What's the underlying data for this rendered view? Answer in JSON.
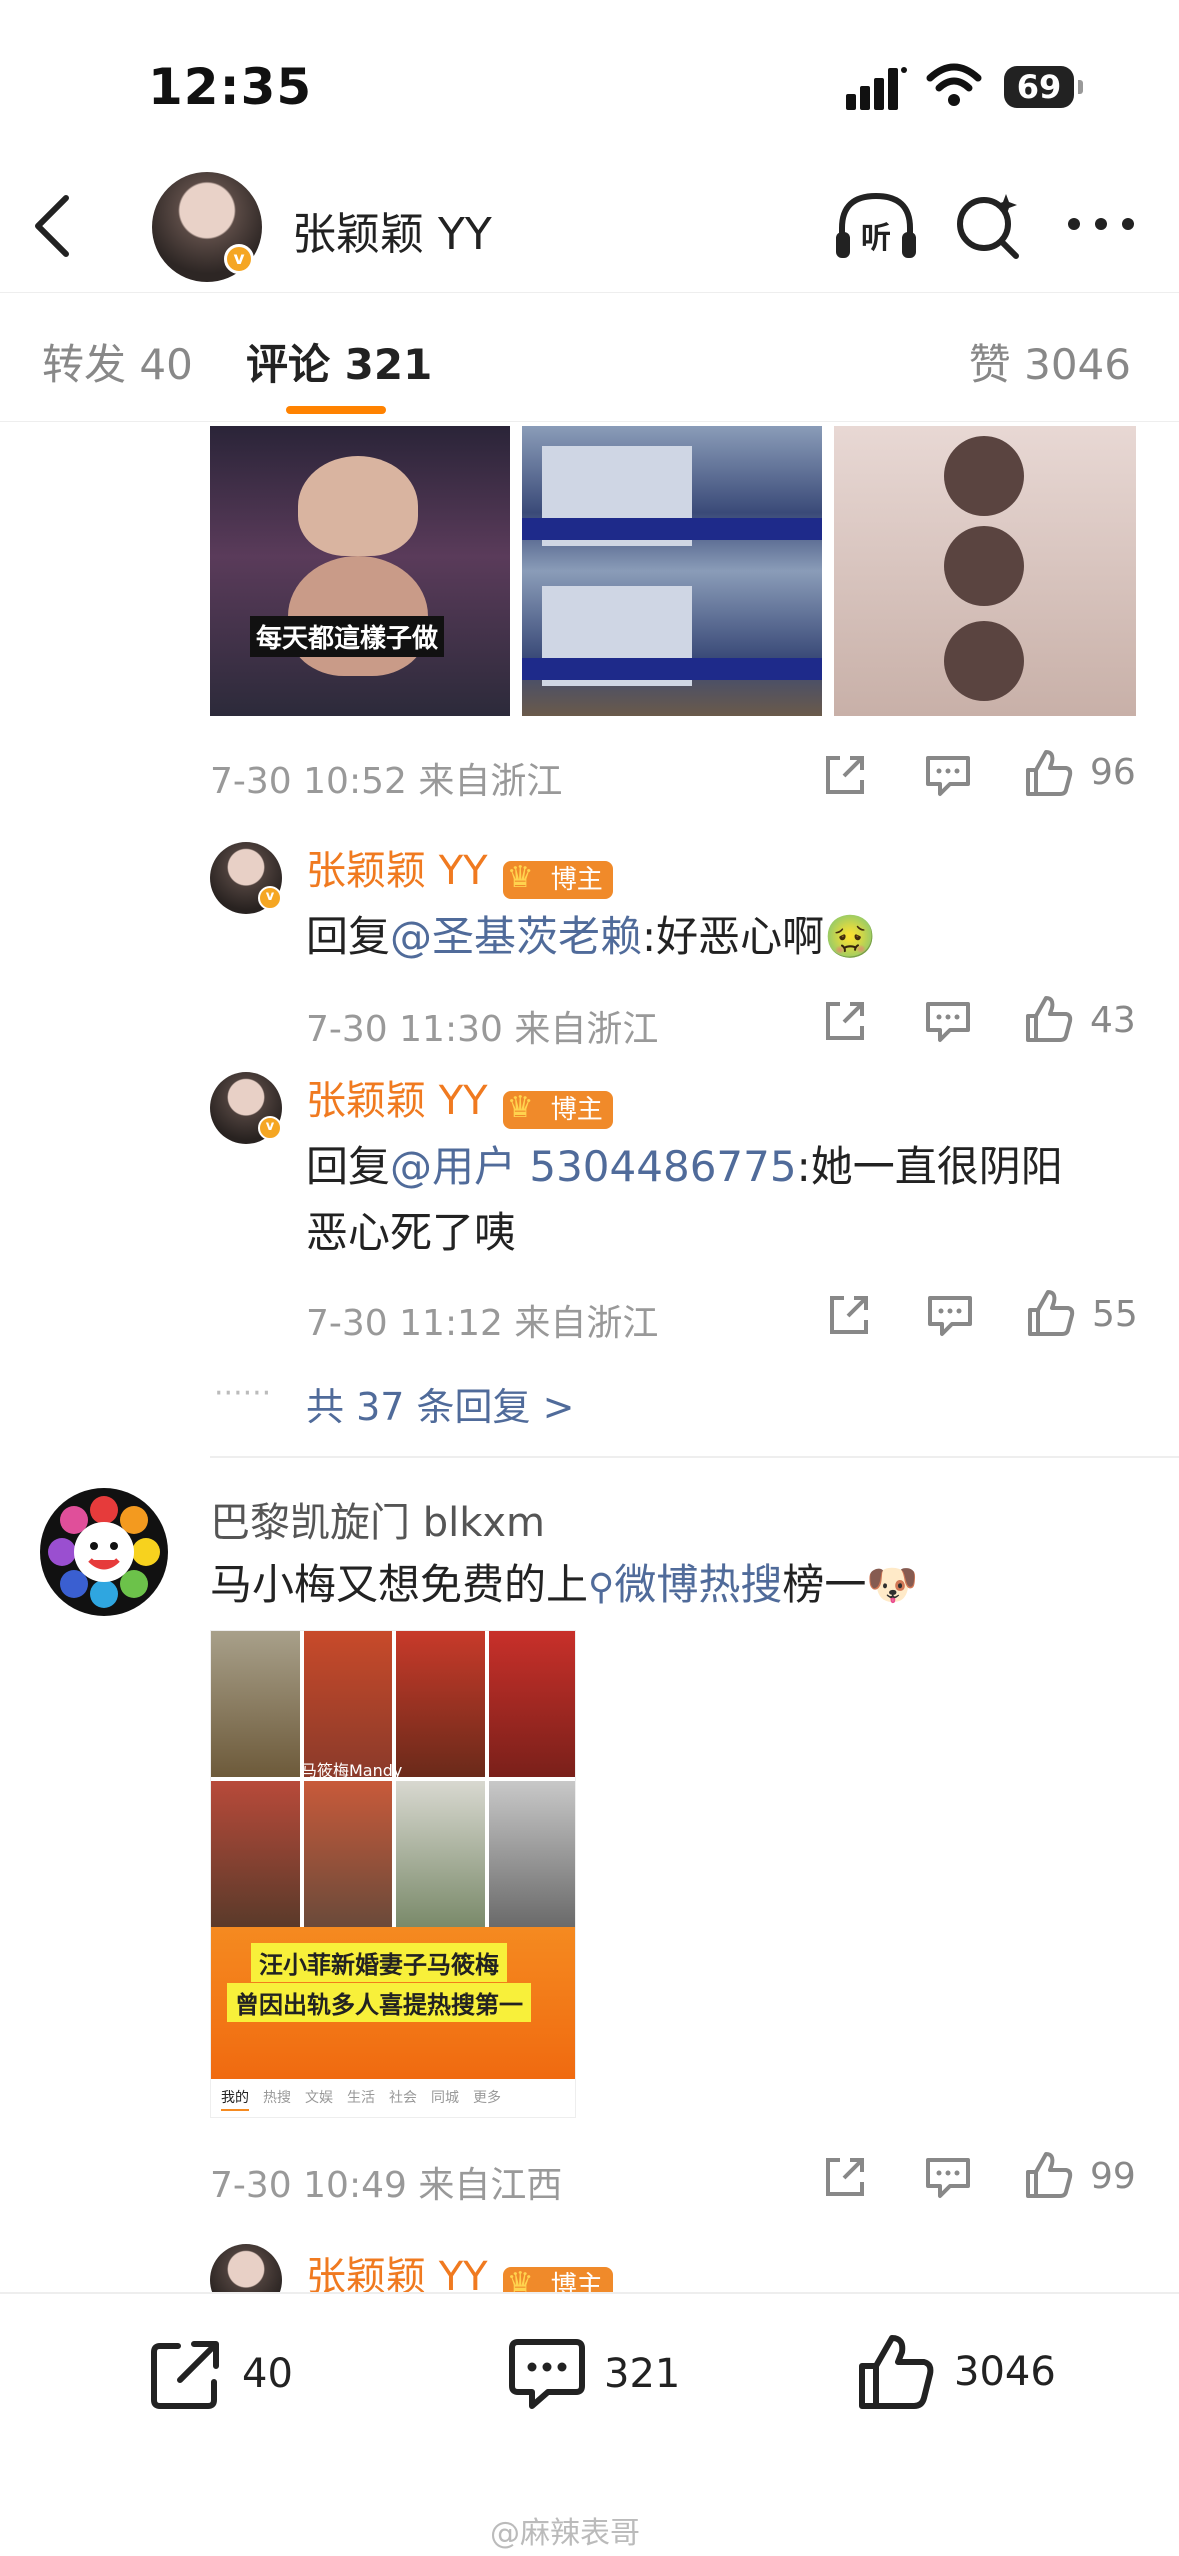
{
  "status_bar": {
    "time": "12:35",
    "battery": "69"
  },
  "header": {
    "user_name": "张颖颖 YY",
    "verified_badge": "v"
  },
  "tabs": {
    "repost_label": "转发",
    "repost_count": "40",
    "comment_label": "评论",
    "comment_count": "321",
    "like_label": "赞",
    "like_count": "3046"
  },
  "comment1": {
    "meta": "7-30 10:52  来自浙江",
    "like_count": "96",
    "thumb_caption": "每天都這樣子做"
  },
  "reply1": {
    "name": "张颖颖 YY",
    "badge": "博主",
    "reply_prefix": "回复",
    "mention": "@圣基茨老赖",
    "text": ":好恶心啊",
    "emoji": "🤢",
    "meta": "7-30 11:30  来自浙江",
    "like_count": "43"
  },
  "reply2": {
    "name": "张颖颖 YY",
    "badge": "博主",
    "reply_prefix": "回复",
    "mention": "@用户 5304486775",
    "text_line1": ":她一直很阴阳",
    "text_line2": "恶心死了咦",
    "meta": "7-30 11:12  来自浙江",
    "like_count": "55"
  },
  "more_replies": {
    "dots": "······",
    "label": "共 37 条回复 >"
  },
  "comment2": {
    "name": "巴黎凯旋门 blkxm",
    "text_before": "马小梅又想免费的上",
    "hot_search": "微博热搜",
    "text_after": "榜一",
    "emoji": "🐶",
    "image_banner_line1": "汪小菲新婚妻子马筱梅",
    "image_banner_line2": "曾因出轨多人喜提热搜第一",
    "image_name_tag": "马筱梅Mandy",
    "image_nav": [
      "我的",
      "热搜",
      "文娱",
      "生活",
      "社会",
      "同城",
      "更多"
    ],
    "meta": "7-30 10:49  来自江西",
    "like_count": "99"
  },
  "reply3": {
    "name": "张颖颖 YY",
    "badge": "博主"
  },
  "bottom_bar": {
    "repost_count": "40",
    "comment_count": "321",
    "like_count": "3046"
  },
  "watermark": "@麻辣表哥"
}
